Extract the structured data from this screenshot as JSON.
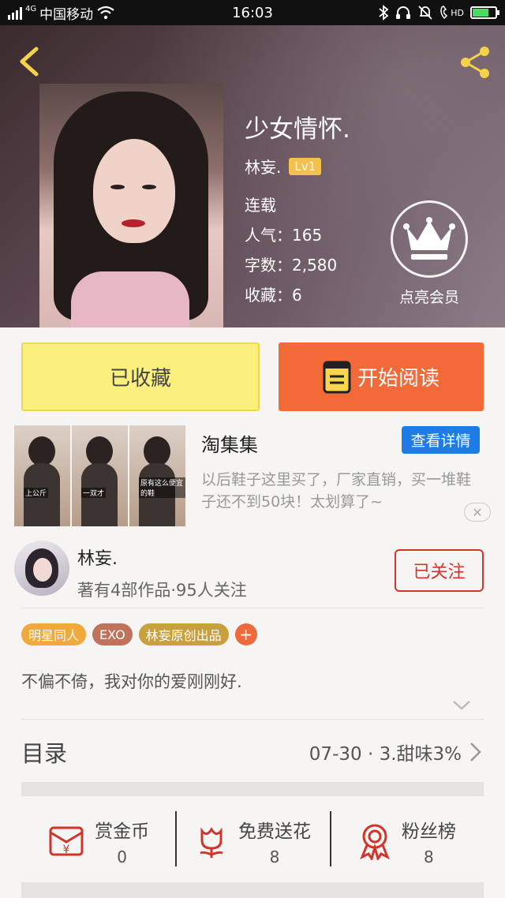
{
  "status_bar": {
    "signal_label": "4G",
    "carrier": "中国移动",
    "time": "16:03",
    "hd_label": "HD",
    "battery_level": 0.7,
    "icons": [
      "signal-icon",
      "wifi-icon",
      "bluetooth-icon",
      "headphone-icon",
      "silent-icon",
      "hd-call-icon",
      "battery-icon"
    ]
  },
  "hero": {
    "title": "少女情怀.",
    "author": "林妄.",
    "level": "Lv1",
    "status": "连载",
    "popularity": "人气：165",
    "word_count": "字数：2,580",
    "favorites": "收藏：6",
    "vip_label": "点亮会员"
  },
  "buttons": {
    "collected": "已收藏",
    "start_reading": "开始阅读"
  },
  "ad": {
    "title": "淘集集",
    "detail_button": "查看详情",
    "description": "以后鞋子这里买了，厂家直销，买一堆鞋子还不到50块！太划算了~",
    "thumb_captions": [
      "上公斤",
      "一双才",
      "原有这么便宜的鞋"
    ],
    "close": "✕"
  },
  "author_section": {
    "name": "林妄.",
    "stats": "著有4部作品·95人关注",
    "follow_button": "已关注"
  },
  "tags": [
    {
      "label": "明星同人",
      "color": "#f2a93b"
    },
    {
      "label": "EXO",
      "color": "#c0725a"
    },
    {
      "label": "林妄原创出品",
      "color": "#c9a03e"
    }
  ],
  "tag_add": "+",
  "intro": "不偏不倚，我对你的爱刚刚好.",
  "toc": {
    "label": "目录",
    "latest": "07-30 · 3.甜味3%"
  },
  "actions": [
    {
      "label": "赏金币",
      "count": "0",
      "icon": "reward-coin-icon"
    },
    {
      "label": "免费送花",
      "count": "8",
      "icon": "flower-icon"
    },
    {
      "label": "粉丝榜",
      "count": "8",
      "icon": "fan-ranking-icon"
    }
  ],
  "colors": {
    "accent_orange": "#f26a38",
    "collected_yellow": "#fbf07d",
    "follow_red": "#d2342b",
    "ad_blue": "#1e7ce6",
    "lv_gold": "#f3c14f"
  }
}
